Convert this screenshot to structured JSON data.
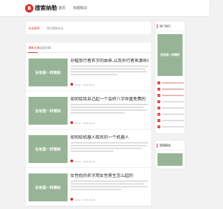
{
  "brand": {
    "logo_glyph": "B",
    "name": "搜索纳勒"
  },
  "nav": {
    "items": [
      "首页",
      "标题知识"
    ]
  },
  "breadcrumb": {
    "current": "站长推荐",
    "path": "首页搜狗站长"
  },
  "tabs": {
    "items": [
      "最新文章",
      "全部文章"
    ]
  },
  "placeholder_text": "没有图一样精彩",
  "posts": [
    {
      "title": "孙楷受行者名字的由来,以及孙行者来源命名的",
      "author": "admin",
      "date": "2023-06-12"
    },
    {
      "title": "如何给我自己起一个会终八字命盘免费的",
      "author": "admin",
      "date": "2023-06-12"
    },
    {
      "title": "如何给机器人取名的一个机器人",
      "author": "admin",
      "date": "2023-06-12"
    },
    {
      "title": "女性姓的名字用女性男生怎么起的",
      "author": "admin",
      "date": "2023-06-12"
    }
  ],
  "sidebar": {
    "hot_title": "热门排行",
    "recommend_title": "图图精选",
    "hot_items": [
      "1",
      "2",
      "3",
      "4",
      "5",
      "6",
      "7",
      "8"
    ]
  },
  "colors": {
    "accent": "#d9342b",
    "thumb": "#97b596"
  }
}
